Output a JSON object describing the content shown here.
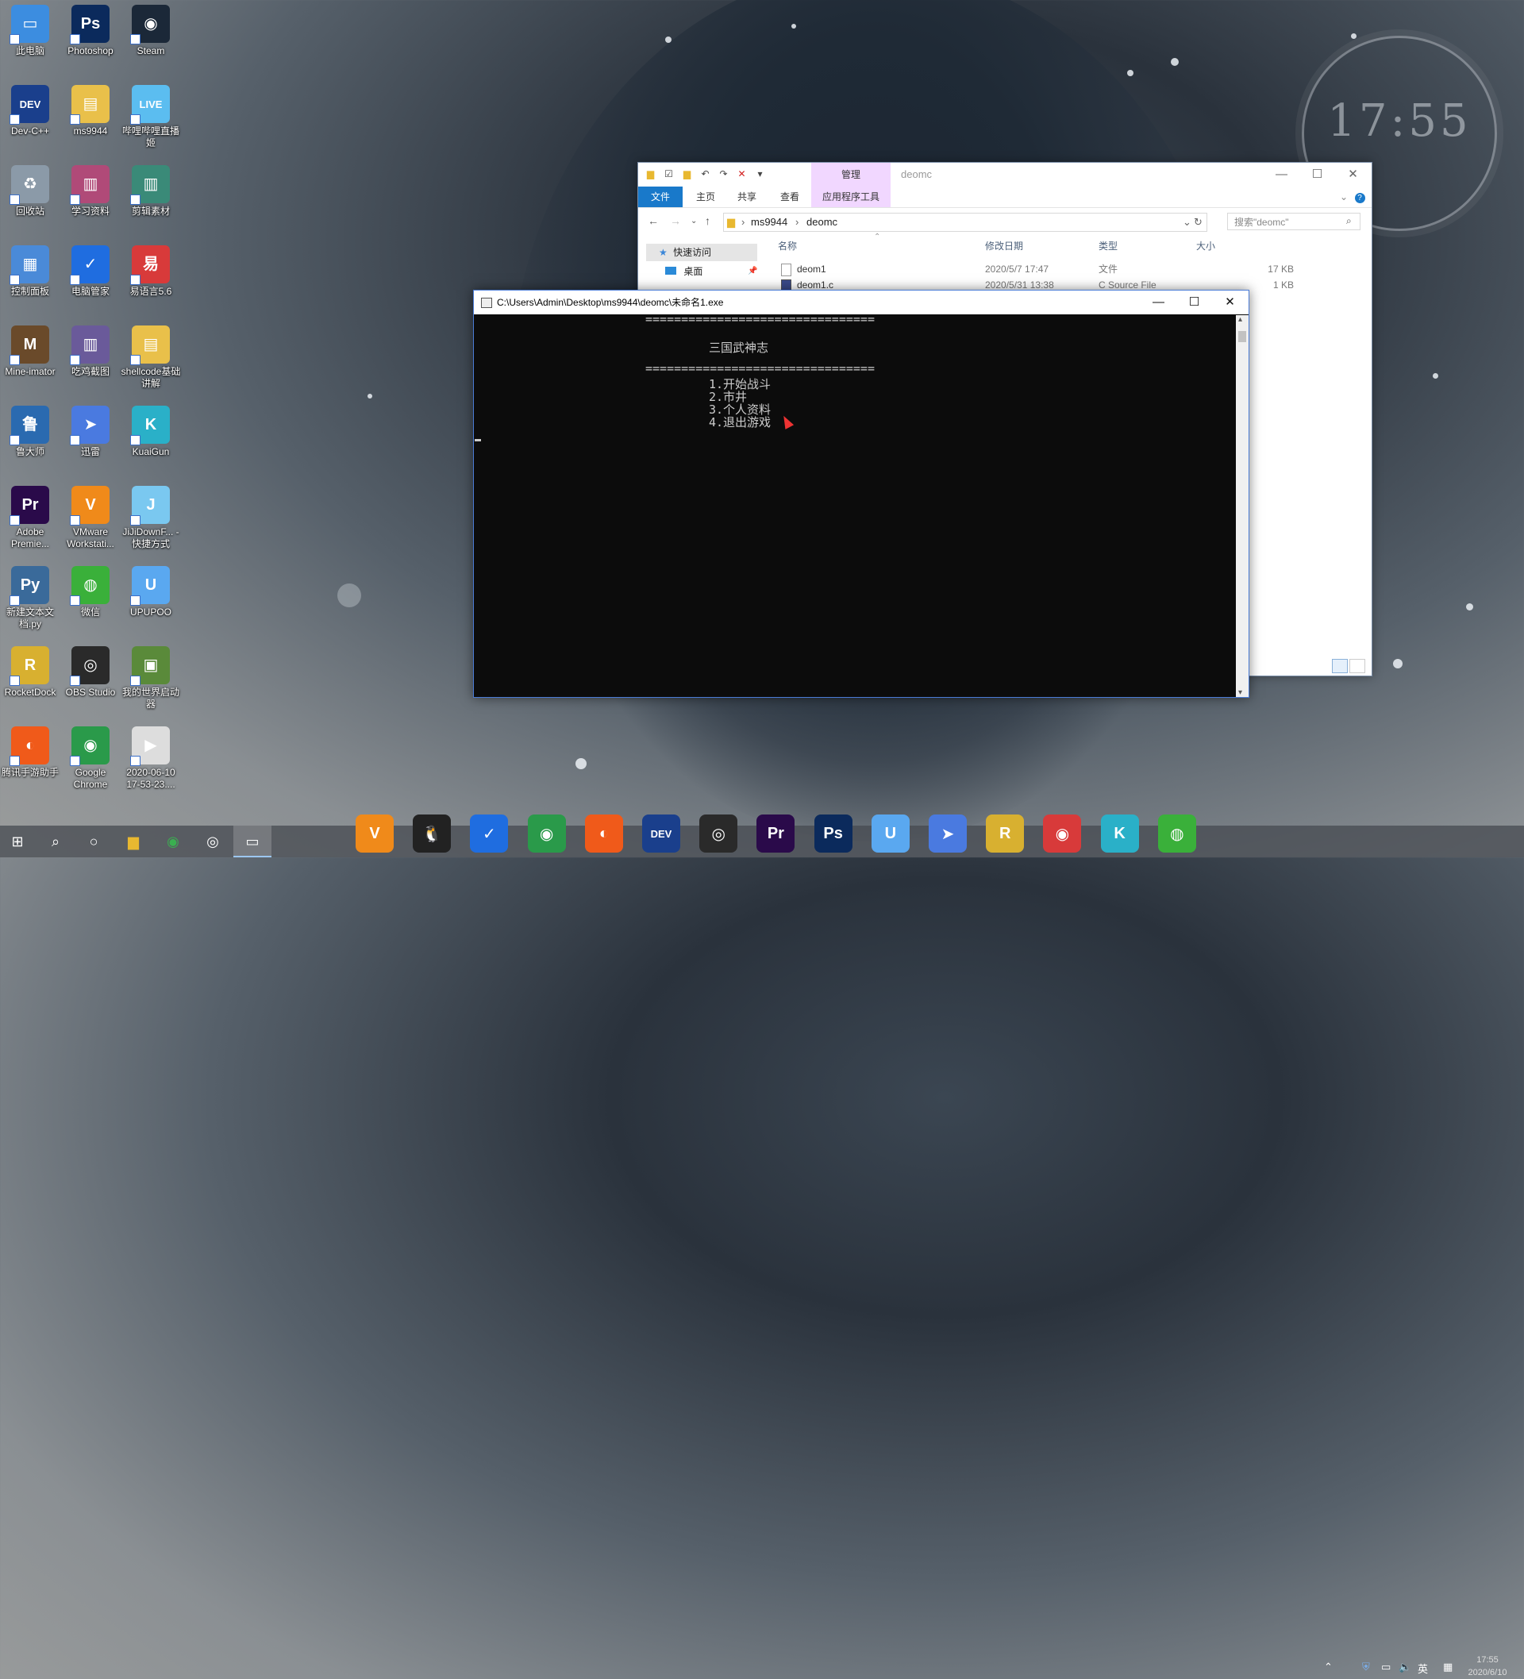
{
  "desktop": {
    "clock_widget": "17:55",
    "icons": [
      {
        "label": "此电脑",
        "glyph": "▭",
        "color": "#3c8de0"
      },
      {
        "label": "Photoshop",
        "glyph": "Ps",
        "color": "#0b2a5c"
      },
      {
        "label": "Steam",
        "glyph": "◉",
        "color": "#1b2838"
      },
      {
        "label": "Dev-C++",
        "glyph": "DEV",
        "color": "#1a3f8c"
      },
      {
        "label": "ms9944",
        "glyph": "▤",
        "color": "#e9c04a"
      },
      {
        "label": "哔哩哔哩直播姬",
        "glyph": "LIVE",
        "color": "#5bbdf0"
      },
      {
        "label": "回收站",
        "glyph": "♻",
        "color": "#8b9aa8"
      },
      {
        "label": "学习资料",
        "glyph": "▥",
        "color": "#b04a78"
      },
      {
        "label": "剪辑素材",
        "glyph": "▥",
        "color": "#3a8a78"
      },
      {
        "label": "控制面板",
        "glyph": "▦",
        "color": "#4a8ad8"
      },
      {
        "label": "电脑管家",
        "glyph": "✓",
        "color": "#1f6de0"
      },
      {
        "label": "易语言5.6",
        "glyph": "易",
        "color": "#d83a3a"
      },
      {
        "label": "Mine-imator",
        "glyph": "M",
        "color": "#6a4a2a"
      },
      {
        "label": "吃鸡截图",
        "glyph": "▥",
        "color": "#6a5a9a"
      },
      {
        "label": "shellcode基础讲解",
        "glyph": "▤",
        "color": "#e9c04a"
      },
      {
        "label": "鲁大师",
        "glyph": "鲁",
        "color": "#2a6ab0"
      },
      {
        "label": "迅雷",
        "glyph": "➤",
        "color": "#4a7ae0"
      },
      {
        "label": "KuaiGun",
        "glyph": "K",
        "color": "#2ab0c8"
      },
      {
        "label": "Adobe Premie...",
        "glyph": "Pr",
        "color": "#2a0a4a"
      },
      {
        "label": "VMware Workstati...",
        "glyph": "V",
        "color": "#f08a1a"
      },
      {
        "label": "JiJiDownF... - 快捷方式",
        "glyph": "J",
        "color": "#7ac8f0"
      },
      {
        "label": "新建文本文档.py",
        "glyph": "Py",
        "color": "#3a6a9a"
      },
      {
        "label": "微信",
        "glyph": "◍",
        "color": "#3ab03a"
      },
      {
        "label": "UPUPOO",
        "glyph": "U",
        "color": "#5aa8f0"
      },
      {
        "label": "RocketDock",
        "glyph": "R",
        "color": "#d8b030"
      },
      {
        "label": "OBS Studio",
        "glyph": "◎",
        "color": "#2a2a2a"
      },
      {
        "label": "我的世界启动器",
        "glyph": "▣",
        "color": "#5a8a3a"
      },
      {
        "label": "腾讯手游助手",
        "glyph": "◐",
        "color": "#f05a1a"
      },
      {
        "label": "Google Chrome",
        "glyph": "◉",
        "color": "#2a9a4a"
      },
      {
        "label": "2020-06-10 17-53-23....",
        "glyph": "▶",
        "color": "#ddd"
      }
    ]
  },
  "explorer": {
    "title": "deomc",
    "manage_tab": "管理",
    "ribbon_tabs": [
      "文件",
      "主页",
      "共享",
      "查看"
    ],
    "app_tools_tab": "应用程序工具",
    "address": [
      "ms9944",
      "deomc"
    ],
    "search_placeholder": "搜索\"deomc\"",
    "nav": {
      "quick_access": "快速访问",
      "desktop": "桌面"
    },
    "columns": {
      "name": "名称",
      "date": "修改日期",
      "type": "类型",
      "size": "大小"
    },
    "files": [
      {
        "name": "deom1",
        "date": "2020/5/7 17:47",
        "type": "文件",
        "size": "17 KB"
      },
      {
        "name": "deom1.c",
        "date": "2020/5/31 13:38",
        "type": "C Source File",
        "size": "1 KB"
      }
    ]
  },
  "console": {
    "title": "C:\\Users\\Admin\\Desktop\\ms9944\\deomc\\未命名1.exe",
    "separator": "================================",
    "game_title": "三国武神志",
    "menu": [
      "1.开始战斗",
      "2.市井",
      "3.个人资料",
      "4.退出游戏"
    ]
  },
  "taskbar": {
    "clock_time": "17:55",
    "clock_date": "2020/6/10",
    "tray_lang": "英",
    "apps": [
      {
        "name": "vmware",
        "glyph": "V",
        "color": "#f08a1a"
      },
      {
        "name": "qq",
        "glyph": "🐧",
        "color": "#222"
      },
      {
        "name": "pc-manager",
        "glyph": "✓",
        "color": "#1f6de0"
      },
      {
        "name": "chrome",
        "glyph": "◉",
        "color": "#2a9a4a"
      },
      {
        "name": "game-helper",
        "glyph": "◐",
        "color": "#f05a1a"
      },
      {
        "name": "devcpp",
        "glyph": "DEV",
        "color": "#1a3f8c"
      },
      {
        "name": "obs",
        "glyph": "◎",
        "color": "#2a2a2a"
      },
      {
        "name": "premiere",
        "glyph": "Pr",
        "color": "#2a0a4a"
      },
      {
        "name": "photoshop",
        "glyph": "Ps",
        "color": "#0b2a5c"
      },
      {
        "name": "upupoo",
        "glyph": "U",
        "color": "#5aa8f0"
      },
      {
        "name": "xunlei",
        "glyph": "➤",
        "color": "#4a7ae0"
      },
      {
        "name": "rocketdock",
        "glyph": "R",
        "color": "#d8b030"
      },
      {
        "name": "netease-music",
        "glyph": "◉",
        "color": "#d83a3a"
      },
      {
        "name": "kuaigun",
        "glyph": "K",
        "color": "#2ab0c8"
      },
      {
        "name": "wechat",
        "glyph": "◍",
        "color": "#3ab03a"
      }
    ]
  }
}
